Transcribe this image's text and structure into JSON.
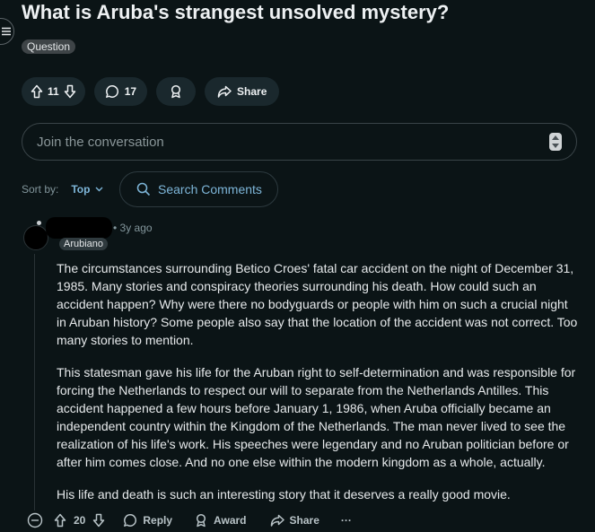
{
  "post": {
    "title": "What is Aruba's strangest unsolved mystery?",
    "flair": "Question",
    "vote_count": "11",
    "comment_count": "17",
    "share_label": "Share"
  },
  "composer": {
    "placeholder": "Join the conversation"
  },
  "sort": {
    "label": "Sort by:",
    "value": "Top"
  },
  "search": {
    "label": "Search Comments"
  },
  "comment": {
    "time": "• 3y ago",
    "flair": "Arubiano",
    "paragraphs": [
      "The circumstances surrounding Betico Croes' fatal car accident on the night of December 31, 1985. Many stories and conspiracy theories surrounding his death. How could such an accident happen? Why were there no bodyguards or people with him on such a crucial night in Aruban history? Some people also say that the location of the accident was not correct. Too many stories to mention.",
      "This statesman gave his life for the Aruban right to self-determination and was responsible for forcing the Netherlands to respect our will to separate from the Netherlands Antilles. This accident happened a few hours before January 1, 1986, when Aruba officially became an independent country within the Kingdom of the Netherlands. The man never lived to see the realization of his life's work. His speeches were legendary and no Aruban politician before or after him comes close. And no one else within the modern kingdom as a whole, actually.",
      "His life and death is such an interesting story that it deserves a really good movie."
    ],
    "vote_count": "20",
    "reply_label": "Reply",
    "award_label": "Award",
    "share_label": "Share",
    "more_label": "···"
  }
}
